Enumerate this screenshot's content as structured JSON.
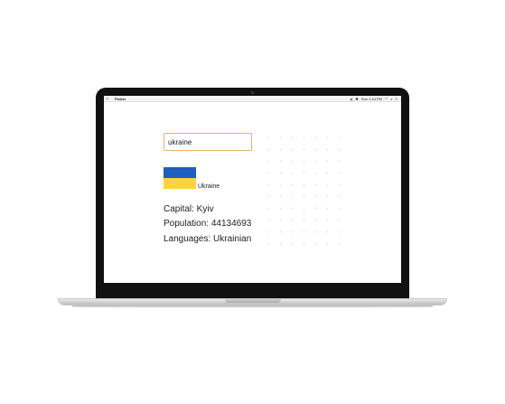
{
  "menubar": {
    "app_name": "Finder",
    "apple_icon": "apple-icon",
    "clock": "Sun 1:44 PM"
  },
  "search": {
    "value": "ukraine"
  },
  "country": {
    "name": "Ukraine",
    "flag_colors": {
      "top": "#1f5fbf",
      "bottom": "#ffd43b"
    },
    "capital_label": "Capital: Kyiv",
    "population_label": "Population: 44134693",
    "languages_label": "Languages: Ukrainian"
  },
  "colors": {
    "input_border": "#e8b36a"
  }
}
